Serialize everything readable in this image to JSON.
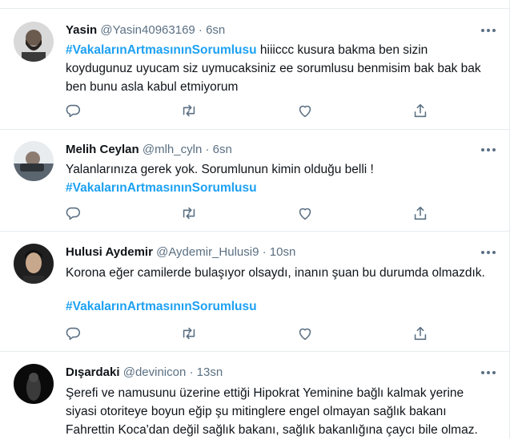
{
  "tweets": [
    {
      "name": "Yasin",
      "handle": "@Yasin40963169",
      "dot": "·",
      "time": "6sn",
      "hashtag": "#VakalarınArtmasınınSorumlusu",
      "text": "hiiiccc kusura bakma ben sizin koydugunuz uyucam siz uymucaksiniz ee sorumlusu benmisim bak bak bak ben bunu asla kabul etmiyorum"
    },
    {
      "name": "Melih Ceylan",
      "handle": "@mlh_cyln",
      "dot": "·",
      "time": "6sn",
      "text": "Yalanlarınıza gerek yok. Sorumlunun kimin olduğu belli !",
      "hashtag": "#VakalarınArtmasınınSorumlusu"
    },
    {
      "name": "Hulusi Aydemir",
      "handle": "@Aydemir_Hulusi9",
      "dot": "·",
      "time": "10sn",
      "text": "Korona eğer camilerde bulaşıyor olsaydı, inanın şuan bu durumda olmazdık.",
      "hashtag": "#VakalarınArtmasınınSorumlusu"
    },
    {
      "name": "Dışardaki",
      "handle": "@devinicon",
      "dot": "·",
      "time": "13sn",
      "text": "Şerefi ve namusunu üzerine ettiği Hipokrat Yeminine bağlı kalmak yerine siyasi otoriteye boyun eğip şu mitinglere engel olmayan sağlık bakanı Fahrettin Koca'dan değil sağlık bakanı, sağlık bakanlığına çaycı bile olmaz."
    }
  ],
  "icons": {
    "reply": "reply-icon",
    "retweet": "retweet-icon",
    "like": "heart-icon",
    "share": "share-icon",
    "more": "more-icon"
  },
  "colors": {
    "hashtag": "#1da1f2",
    "secondary_text": "#5b7083",
    "divider": "#e6ecf0"
  }
}
